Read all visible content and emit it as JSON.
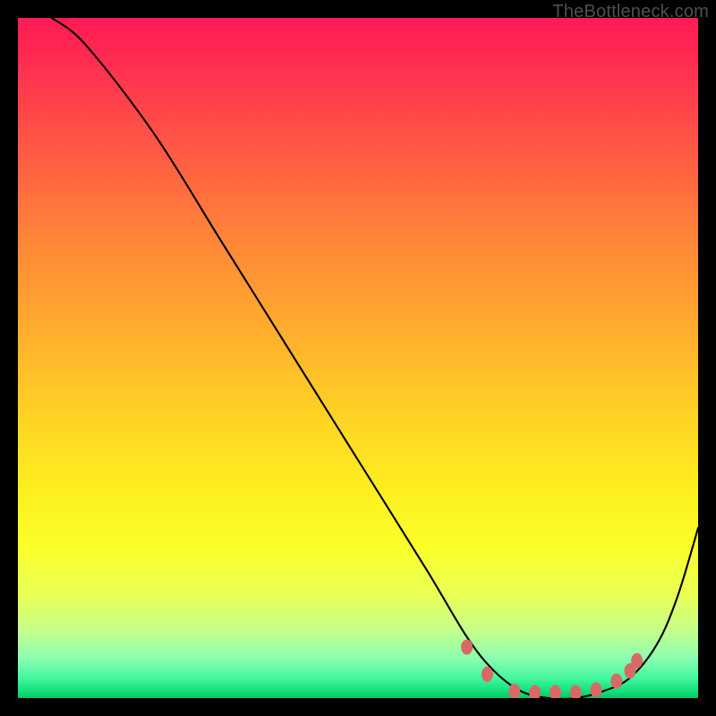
{
  "watermark": "TheBottleneck.com",
  "chart_data": {
    "type": "line",
    "title": "",
    "xlabel": "",
    "ylabel": "",
    "xlim": [
      0,
      100
    ],
    "ylim": [
      0,
      100
    ],
    "series": [
      {
        "name": "bottleneck-curve",
        "x": [
          5,
          10,
          20,
          30,
          40,
          50,
          60,
          66,
          70,
          74,
          78,
          82,
          86,
          90,
          94,
          97,
          100
        ],
        "values": [
          100,
          96,
          83,
          67,
          51,
          35,
          19,
          9,
          4,
          1,
          0,
          0,
          1,
          3,
          8,
          15,
          25
        ]
      }
    ],
    "markers": {
      "name": "highlight-dots",
      "x": [
        66,
        69,
        73,
        76,
        79,
        82,
        85,
        88,
        90,
        91
      ],
      "values": [
        7.5,
        3.5,
        1,
        0.8,
        0.8,
        0.8,
        1.2,
        2.5,
        4,
        5.5
      ]
    }
  }
}
